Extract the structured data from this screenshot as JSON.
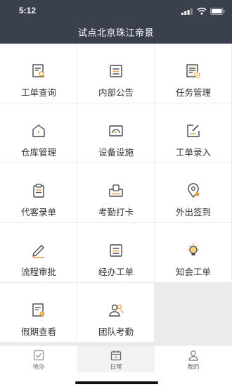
{
  "status_bar": {
    "time": "5:12"
  },
  "header": {
    "title": "试点北京珠江帝景"
  },
  "menu": [
    {
      "label": "工单查询",
      "icon": "work-order-search-icon"
    },
    {
      "label": "内部公告",
      "icon": "announcement-icon"
    },
    {
      "label": "任务管理",
      "icon": "task-management-icon"
    },
    {
      "label": "仓库管理",
      "icon": "warehouse-icon"
    },
    {
      "label": "设备设施",
      "icon": "equipment-gauge-icon"
    },
    {
      "label": "工单录入",
      "icon": "work-order-entry-icon"
    },
    {
      "label": "代客录单",
      "icon": "clipboard-icon"
    },
    {
      "label": "考勤打卡",
      "icon": "punch-clock-icon"
    },
    {
      "label": "外出签到",
      "icon": "location-checkin-icon"
    },
    {
      "label": "流程审批",
      "icon": "pen-approval-icon"
    },
    {
      "label": "经办工单",
      "icon": "handled-orders-icon"
    },
    {
      "label": "知会工单",
      "icon": "lightbulb-icon"
    },
    {
      "label": "假期查看",
      "icon": "leave-calendar-icon"
    },
    {
      "label": "团队考勤",
      "icon": "team-attendance-icon"
    }
  ],
  "tabs": [
    {
      "label": "待办",
      "icon": "todo-check-icon",
      "active": false
    },
    {
      "label": "日常",
      "icon": "calendar-icon",
      "active": true
    },
    {
      "label": "我的",
      "icon": "profile-icon",
      "active": false
    }
  ],
  "colors": {
    "header_bg": "#3a404e",
    "icon_stroke": "#444a55",
    "accent": "#e8a23a"
  }
}
